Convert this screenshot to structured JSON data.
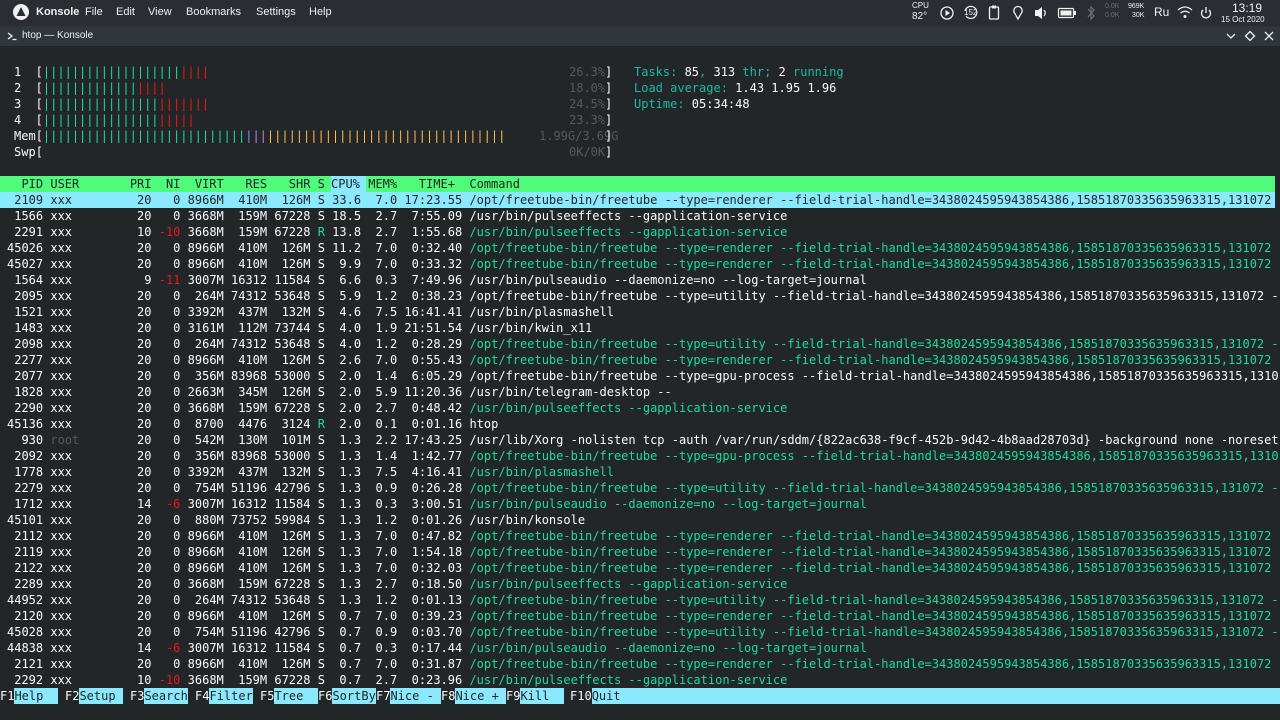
{
  "menubar": {
    "app_name": "Konsole",
    "menus": [
      "File",
      "Edit",
      "View",
      "Bookmarks",
      "Settings",
      "Help"
    ],
    "cpu_label": "CPU",
    "cpu_temp": "82°",
    "badge_num": "152",
    "net_down": "969K",
    "net_down_b": "0.0K",
    "net_up": "30K",
    "net_up_b": "0.0K",
    "lang": "Ru",
    "time": "13:19",
    "date": "15 Oct 2020"
  },
  "window": {
    "title": "htop — Konsole"
  },
  "meters": {
    "cpus": [
      {
        "label": "1",
        "pct": "26.3%"
      },
      {
        "label": "2",
        "pct": "18.0%"
      },
      {
        "label": "3",
        "pct": "24.5%"
      },
      {
        "label": "4",
        "pct": "23.3%"
      }
    ],
    "mem": {
      "label": "Mem",
      "value": "1.99G/3.69G"
    },
    "swp": {
      "label": "Swp",
      "value": "0K/0K"
    },
    "tasks_label": "Tasks: ",
    "tasks_count": "85",
    "tasks_sep": ", ",
    "tasks_thr": "313",
    "tasks_thr_label": " thr; ",
    "tasks_running": "2",
    "tasks_running_label": " running",
    "load_label": "Load average: ",
    "load_1": "1.43",
    "load_5": "1.95",
    "load_15": "1.96",
    "uptime_label": "Uptime: ",
    "uptime": "05:34:48"
  },
  "header": "  PID USER       PRI  NI  VIRT   RES   SHR S CPU% MEM%   TIME+  Command",
  "processes": [
    {
      "pid": "2109",
      "user": "xxx",
      "pri": "20",
      "ni": "0",
      "virt": "8966M",
      "res": "410M",
      "shr": "126M",
      "s": "S",
      "cpu": "33.6",
      "mem": "7.0",
      "time": "17:23.55",
      "cmd": "/opt/freetube-bin/freetube --type=renderer --field-trial-handle=3438024595943854386,15851870335635963315,131072",
      "thread": false
    },
    {
      "pid": "1566",
      "user": "xxx",
      "pri": "20",
      "ni": "0",
      "virt": "3668M",
      "res": "159M",
      "shr": "67228",
      "s": "S",
      "cpu": "18.5",
      "mem": "2.7",
      "time": "7:55.09",
      "cmd": "/usr/bin/pulseeffects --gapplication-service",
      "thread": false
    },
    {
      "pid": "2291",
      "user": "xxx",
      "pri": "10",
      "ni": "-10",
      "virt": "3668M",
      "res": "159M",
      "shr": "67228",
      "s": "R",
      "cpu": "13.8",
      "mem": "2.7",
      "time": "1:55.68",
      "cmd": "/usr/bin/pulseeffects --gapplication-service",
      "thread": true
    },
    {
      "pid": "45026",
      "user": "xxx",
      "pri": "20",
      "ni": "0",
      "virt": "8966M",
      "res": "410M",
      "shr": "126M",
      "s": "S",
      "cpu": "11.2",
      "mem": "7.0",
      "time": "0:32.40",
      "cmd": "/opt/freetube-bin/freetube --type=renderer --field-trial-handle=3438024595943854386,15851870335635963315,131072",
      "thread": true
    },
    {
      "pid": "45027",
      "user": "xxx",
      "pri": "20",
      "ni": "0",
      "virt": "8966M",
      "res": "410M",
      "shr": "126M",
      "s": "S",
      "cpu": "9.9",
      "mem": "7.0",
      "time": "0:33.32",
      "cmd": "/opt/freetube-bin/freetube --type=renderer --field-trial-handle=3438024595943854386,15851870335635963315,131072",
      "thread": true
    },
    {
      "pid": "1564",
      "user": "xxx",
      "pri": "9",
      "ni": "-11",
      "virt": "3007M",
      "res": "16312",
      "shr": "11584",
      "s": "S",
      "cpu": "6.6",
      "mem": "0.3",
      "time": "7:49.96",
      "cmd": "/usr/bin/pulseaudio --daemonize=no --log-target=journal",
      "thread": false
    },
    {
      "pid": "2095",
      "user": "xxx",
      "pri": "20",
      "ni": "0",
      "virt": "264M",
      "res": "74312",
      "shr": "53648",
      "s": "S",
      "cpu": "5.9",
      "mem": "1.2",
      "time": "0:38.23",
      "cmd": "/opt/freetube-bin/freetube --type=utility --field-trial-handle=3438024595943854386,15851870335635963315,131072 -",
      "thread": false
    },
    {
      "pid": "1521",
      "user": "xxx",
      "pri": "20",
      "ni": "0",
      "virt": "3392M",
      "res": "437M",
      "shr": "132M",
      "s": "S",
      "cpu": "4.6",
      "mem": "7.5",
      "time": "16:41.41",
      "cmd": "/usr/bin/plasmashell",
      "thread": false
    },
    {
      "pid": "1483",
      "user": "xxx",
      "pri": "20",
      "ni": "0",
      "virt": "3161M",
      "res": "112M",
      "shr": "73744",
      "s": "S",
      "cpu": "4.0",
      "mem": "1.9",
      "time": "21:51.54",
      "cmd": "/usr/bin/kwin_x11",
      "thread": false
    },
    {
      "pid": "2098",
      "user": "xxx",
      "pri": "20",
      "ni": "0",
      "virt": "264M",
      "res": "74312",
      "shr": "53648",
      "s": "S",
      "cpu": "4.0",
      "mem": "1.2",
      "time": "0:28.29",
      "cmd": "/opt/freetube-bin/freetube --type=utility --field-trial-handle=3438024595943854386,15851870335635963315,131072 -",
      "thread": true
    },
    {
      "pid": "2277",
      "user": "xxx",
      "pri": "20",
      "ni": "0",
      "virt": "8966M",
      "res": "410M",
      "shr": "126M",
      "s": "S",
      "cpu": "2.6",
      "mem": "7.0",
      "time": "0:55.43",
      "cmd": "/opt/freetube-bin/freetube --type=renderer --field-trial-handle=3438024595943854386,15851870335635963315,131072",
      "thread": true
    },
    {
      "pid": "2077",
      "user": "xxx",
      "pri": "20",
      "ni": "0",
      "virt": "356M",
      "res": "83968",
      "shr": "53000",
      "s": "S",
      "cpu": "2.0",
      "mem": "1.4",
      "time": "6:05.29",
      "cmd": "/opt/freetube-bin/freetube --type=gpu-process --field-trial-handle=3438024595943854386,15851870335635963315,1310",
      "thread": false
    },
    {
      "pid": "1828",
      "user": "xxx",
      "pri": "20",
      "ni": "0",
      "virt": "2663M",
      "res": "345M",
      "shr": "126M",
      "s": "S",
      "cpu": "2.0",
      "mem": "5.9",
      "time": "11:20.36",
      "cmd": "/usr/bin/telegram-desktop --",
      "thread": false
    },
    {
      "pid": "2290",
      "user": "xxx",
      "pri": "20",
      "ni": "0",
      "virt": "3668M",
      "res": "159M",
      "shr": "67228",
      "s": "S",
      "cpu": "2.0",
      "mem": "2.7",
      "time": "0:48.42",
      "cmd": "/usr/bin/pulseeffects --gapplication-service",
      "thread": true
    },
    {
      "pid": "45136",
      "user": "xxx",
      "pri": "20",
      "ni": "0",
      "virt": "8700",
      "res": "4476",
      "shr": "3124",
      "s": "R",
      "cpu": "2.0",
      "mem": "0.1",
      "time": "0:01.16",
      "cmd": "htop",
      "thread": false
    },
    {
      "pid": "930",
      "user": "root",
      "pri": "20",
      "ni": "0",
      "virt": "542M",
      "res": "130M",
      "shr": "101M",
      "s": "S",
      "cpu": "1.3",
      "mem": "2.2",
      "time": "17:43.25",
      "cmd": "/usr/lib/Xorg -nolisten tcp -auth /var/run/sddm/{822ac638-f9cf-452b-9d42-4b8aad28703d} -background none -noreset",
      "thread": false
    },
    {
      "pid": "2092",
      "user": "xxx",
      "pri": "20",
      "ni": "0",
      "virt": "356M",
      "res": "83968",
      "shr": "53000",
      "s": "S",
      "cpu": "1.3",
      "mem": "1.4",
      "time": "1:42.77",
      "cmd": "/opt/freetube-bin/freetube --type=gpu-process --field-trial-handle=3438024595943854386,15851870335635963315,1310",
      "thread": true
    },
    {
      "pid": "1778",
      "user": "xxx",
      "pri": "20",
      "ni": "0",
      "virt": "3392M",
      "res": "437M",
      "shr": "132M",
      "s": "S",
      "cpu": "1.3",
      "mem": "7.5",
      "time": "4:16.41",
      "cmd": "/usr/bin/plasmashell",
      "thread": true
    },
    {
      "pid": "2279",
      "user": "xxx",
      "pri": "20",
      "ni": "0",
      "virt": "754M",
      "res": "51196",
      "shr": "42796",
      "s": "S",
      "cpu": "1.3",
      "mem": "0.9",
      "time": "0:26.28",
      "cmd": "/opt/freetube-bin/freetube --type=utility --field-trial-handle=3438024595943854386,15851870335635963315,131072 -",
      "thread": true
    },
    {
      "pid": "1712",
      "user": "xxx",
      "pri": "14",
      "ni": "-6",
      "virt": "3007M",
      "res": "16312",
      "shr": "11584",
      "s": "S",
      "cpu": "1.3",
      "mem": "0.3",
      "time": "3:00.51",
      "cmd": "/usr/bin/pulseaudio --daemonize=no --log-target=journal",
      "thread": true
    },
    {
      "pid": "45101",
      "user": "xxx",
      "pri": "20",
      "ni": "0",
      "virt": "880M",
      "res": "73752",
      "shr": "59984",
      "s": "S",
      "cpu": "1.3",
      "mem": "1.2",
      "time": "0:01.26",
      "cmd": "/usr/bin/konsole",
      "thread": false
    },
    {
      "pid": "2112",
      "user": "xxx",
      "pri": "20",
      "ni": "0",
      "virt": "8966M",
      "res": "410M",
      "shr": "126M",
      "s": "S",
      "cpu": "1.3",
      "mem": "7.0",
      "time": "0:47.82",
      "cmd": "/opt/freetube-bin/freetube --type=renderer --field-trial-handle=3438024595943854386,15851870335635963315,131072",
      "thread": true
    },
    {
      "pid": "2119",
      "user": "xxx",
      "pri": "20",
      "ni": "0",
      "virt": "8966M",
      "res": "410M",
      "shr": "126M",
      "s": "S",
      "cpu": "1.3",
      "mem": "7.0",
      "time": "1:54.18",
      "cmd": "/opt/freetube-bin/freetube --type=renderer --field-trial-handle=3438024595943854386,15851870335635963315,131072",
      "thread": true
    },
    {
      "pid": "2122",
      "user": "xxx",
      "pri": "20",
      "ni": "0",
      "virt": "8966M",
      "res": "410M",
      "shr": "126M",
      "s": "S",
      "cpu": "1.3",
      "mem": "7.0",
      "time": "0:32.03",
      "cmd": "/opt/freetube-bin/freetube --type=renderer --field-trial-handle=3438024595943854386,15851870335635963315,131072",
      "thread": true
    },
    {
      "pid": "2289",
      "user": "xxx",
      "pri": "20",
      "ni": "0",
      "virt": "3668M",
      "res": "159M",
      "shr": "67228",
      "s": "S",
      "cpu": "1.3",
      "mem": "2.7",
      "time": "0:18.50",
      "cmd": "/usr/bin/pulseeffects --gapplication-service",
      "thread": true
    },
    {
      "pid": "44952",
      "user": "xxx",
      "pri": "20",
      "ni": "0",
      "virt": "264M",
      "res": "74312",
      "shr": "53648",
      "s": "S",
      "cpu": "1.3",
      "mem": "1.2",
      "time": "0:01.13",
      "cmd": "/opt/freetube-bin/freetube --type=utility --field-trial-handle=3438024595943854386,15851870335635963315,131072 -",
      "thread": true
    },
    {
      "pid": "2120",
      "user": "xxx",
      "pri": "20",
      "ni": "0",
      "virt": "8966M",
      "res": "410M",
      "shr": "126M",
      "s": "S",
      "cpu": "0.7",
      "mem": "7.0",
      "time": "0:39.23",
      "cmd": "/opt/freetube-bin/freetube --type=renderer --field-trial-handle=3438024595943854386,15851870335635963315,131072",
      "thread": true
    },
    {
      "pid": "45028",
      "user": "xxx",
      "pri": "20",
      "ni": "0",
      "virt": "754M",
      "res": "51196",
      "shr": "42796",
      "s": "S",
      "cpu": "0.7",
      "mem": "0.9",
      "time": "0:03.70",
      "cmd": "/opt/freetube-bin/freetube --type=utility --field-trial-handle=3438024595943854386,15851870335635963315,131072 -",
      "thread": true
    },
    {
      "pid": "44838",
      "user": "xxx",
      "pri": "14",
      "ni": "-6",
      "virt": "3007M",
      "res": "16312",
      "shr": "11584",
      "s": "S",
      "cpu": "0.7",
      "mem": "0.3",
      "time": "0:17.44",
      "cmd": "/usr/bin/pulseaudio --daemonize=no --log-target=journal",
      "thread": true
    },
    {
      "pid": "2121",
      "user": "xxx",
      "pri": "20",
      "ni": "0",
      "virt": "8966M",
      "res": "410M",
      "shr": "126M",
      "s": "S",
      "cpu": "0.7",
      "mem": "7.0",
      "time": "0:31.87",
      "cmd": "/opt/freetube-bin/freetube --type=renderer --field-trial-handle=3438024595943854386,15851870335635963315,131072",
      "thread": true
    },
    {
      "pid": "2292",
      "user": "xxx",
      "pri": "10",
      "ni": "-10",
      "virt": "3668M",
      "res": "159M",
      "shr": "67228",
      "s": "S",
      "cpu": "0.7",
      "mem": "2.7",
      "time": "0:23.96",
      "cmd": "/usr/bin/pulseeffects --gapplication-service",
      "thread": true
    }
  ],
  "footer": [
    {
      "key": "F1",
      "label": "Help  "
    },
    {
      "key": "F2",
      "label": "Setup "
    },
    {
      "key": "F3",
      "label": "Search"
    },
    {
      "key": "F4",
      "label": "Filter"
    },
    {
      "key": "F5",
      "label": "Tree  "
    },
    {
      "key": "F6",
      "label": "SortBy"
    },
    {
      "key": "F7",
      "label": "Nice - "
    },
    {
      "key": "F8",
      "label": "Nice + "
    },
    {
      "key": "F9",
      "label": "Kill  "
    },
    {
      "key": "F10",
      "label": "Quit"
    }
  ],
  "colors": {
    "green": "#1cdc9a",
    "header_bg": "#50fa7b",
    "selection_bg": "#8be9fd",
    "red": "#ed1515",
    "terminal_bg": "#232629"
  }
}
